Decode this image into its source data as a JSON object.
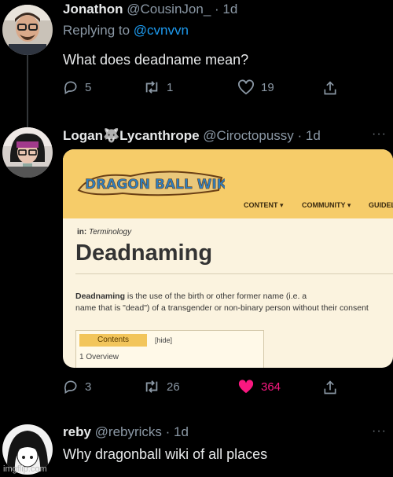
{
  "tweets": [
    {
      "name": "Jonathon",
      "handle": "@CousinJon_",
      "time": "· 1d",
      "replying_prefix": "Replying to",
      "replying_to": "@cvnvvn",
      "text": "What does deadname mean?",
      "counts": {
        "replies": "5",
        "retweets": "1",
        "likes": "19"
      }
    },
    {
      "name": "Logan🐺Lycanthrope",
      "handle": "@Ciroctopussy",
      "time": "· 1d",
      "more": "···",
      "counts": {
        "replies": "3",
        "retweets": "26",
        "likes": "364"
      }
    },
    {
      "name": "reby",
      "handle": "@rebyricks",
      "time": "· 1d",
      "more": "···",
      "text": "Why dragonball wiki of all places"
    }
  ],
  "wiki": {
    "logo_text": "DRAGON BALL WIKI",
    "nav": {
      "content": "CONTENT ▾",
      "community": "COMMUNITY ▾",
      "guide": "GUIDEL"
    },
    "crumb_prefix": "in:",
    "crumb": "Terminology",
    "title": "Deadnaming",
    "body_bold": "Deadnaming",
    "body_line1": " is the use of the birth or other former name (i.e. a",
    "body_line2": "name that is \"dead\") of a transgender or non-binary person without their consent",
    "toc_head": "Contents",
    "toc_hide": "[hide]",
    "toc_item": "1 Overview"
  },
  "watermark": "imgflip.com",
  "colors": {
    "liked": "#f91880",
    "link": "#1d9bf0",
    "muted": "#8b98a5",
    "wiki_header": "#f6cc69"
  }
}
